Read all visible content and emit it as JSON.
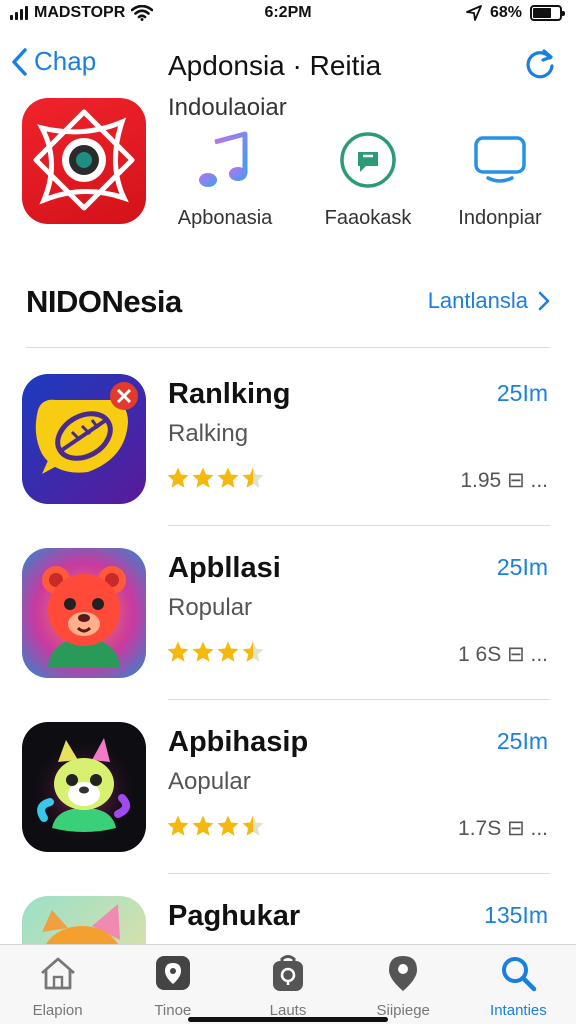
{
  "status": {
    "carrier": "MADSTOPR",
    "time": "6:2PM",
    "battery": "68%",
    "battery_level": 0.68
  },
  "nav": {
    "back_label": "Chap",
    "title": "Apdonsia · Reitia"
  },
  "hero": {
    "subtitle": "Indoulaoiar",
    "quick_links": [
      {
        "label": "Apbonasia",
        "icon": "music-note-icon"
      },
      {
        "label": "Faaokask",
        "icon": "chat-bubble-icon"
      },
      {
        "label": "Indonpiar",
        "icon": "monitor-icon"
      }
    ]
  },
  "section": {
    "title": "NIDONesia",
    "see_all": "Lantlansla"
  },
  "apps": [
    {
      "name": "Ranlking",
      "subtitle": "Ralking",
      "size": "25Im",
      "rating_count": "1.95 ⊟ ...",
      "rating": 3.5
    },
    {
      "name": "Apbllasi",
      "subtitle": "Ropular",
      "size": "25Im",
      "rating_count": "1 6S ⊟ ...",
      "rating": 3.5
    },
    {
      "name": "Apbihasip",
      "subtitle": "Aopular",
      "size": "25Im",
      "rating_count": "1.7S ⊟ ...",
      "rating": 3.5
    },
    {
      "name": "Paghukar",
      "subtitle": "",
      "size": "135Im",
      "rating_count": "",
      "rating": 0
    }
  ],
  "tabs": [
    {
      "label": "Elapion",
      "icon": "home-icon",
      "active": false
    },
    {
      "label": "Tinoe",
      "icon": "map-pin-square-icon",
      "active": false
    },
    {
      "label": "Lauts",
      "icon": "bag-icon",
      "active": false
    },
    {
      "label": "Siipiege",
      "icon": "location-pin-icon",
      "active": false
    },
    {
      "label": "Intanties",
      "icon": "search-icon",
      "active": true
    }
  ],
  "colors": {
    "accent": "#1a7fe0",
    "star": "#f4b90c"
  }
}
